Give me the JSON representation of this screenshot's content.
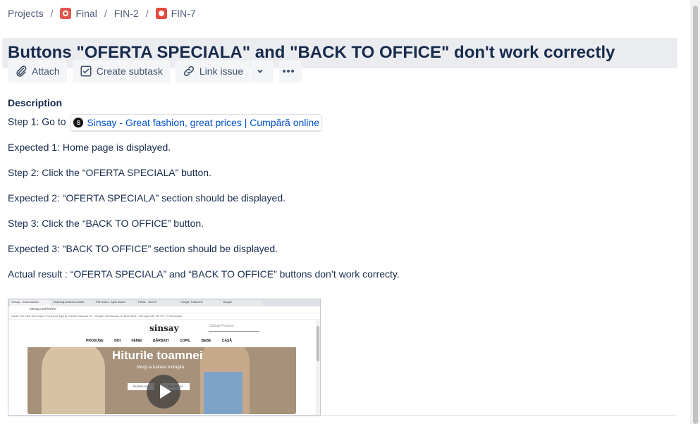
{
  "breadcrumb": {
    "projects": "Projects",
    "project": "Final",
    "parent": "FIN-2",
    "issue": "FIN-7",
    "separator": "/"
  },
  "issue": {
    "title": "Buttons \"OFERTA SPECIALA\" and \"BACK TO OFFICE\" don't work correctly"
  },
  "toolbar": {
    "attach": "Attach",
    "create_subtask": "Create subtask",
    "link_issue": "Link issue"
  },
  "description": {
    "label": "Description",
    "step1_prefix": "Step 1: Go to",
    "link_text": "Sinsay - Great fashion, great prices |  Cumpără online",
    "expected1": "Expected 1: Home page is displayed.",
    "step2": "Step 2: Click the “OFERTA SPECIALA” button.",
    "expected2": "Expected 2: “OFERTA SPECIALA” section should be displayed.",
    "step3": "Step 3: Click the “BACK TO OFFICE” button.",
    "expected3": "Expected 3:  “BACK TO OFFICE” section should be displayed.",
    "actual": "Actual result : “OFERTA SPECIALA” and “BACK TO OFFICE” buttons don’t work correcty."
  },
  "attachment": {
    "tabs": [
      "Sinsay - Great fashion",
      "teaching-week10-solutio",
      "FIN board - Agile Board",
      "FINAL - BUGS",
      "Google Traducere",
      "Google"
    ],
    "address": "sinsay.com/ro/ro/",
    "bookmarks": "Gmail   YouTube   Summary of Vi-Expet   Typing Practice   Manual TR - Google   Introduction to Java   Meet - HR-cgdv-zfy   TM TR - IT Bootcamp",
    "site_logo": "sinsay",
    "search_placeholder": "Căutați Produse",
    "nav": "PRODUSE NOI FEMEI BĂRBAȚI COPIL BEBE CASĂ",
    "hero_title": "Hiturile toamnei",
    "hero_subtitle": "Mergi la haineia indrăgită",
    "hero_btn1": "PENTRU EA",
    "hero_btn2": "PENTRU EL"
  },
  "colors": {
    "title_bg": "#ebecf0",
    "link": "#0052cc",
    "text": "#172b4d",
    "button_bg": "#f4f5f7"
  }
}
